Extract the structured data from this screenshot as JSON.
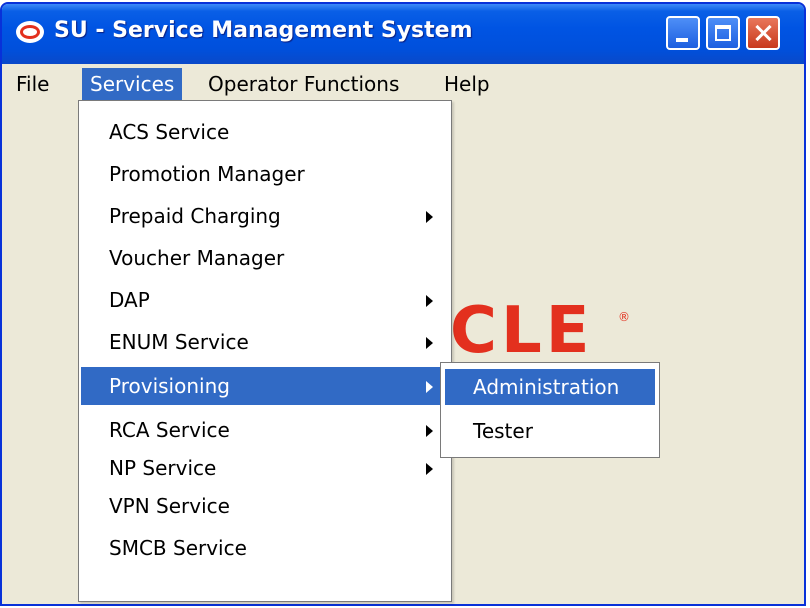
{
  "window": {
    "title": "SU - Service Management System",
    "logo_icon": "oracle-logo-icon"
  },
  "menubar": {
    "items": [
      {
        "label": "File"
      },
      {
        "label": "Services",
        "active": true
      },
      {
        "label": "Operator Functions"
      },
      {
        "label": "Help"
      }
    ]
  },
  "background": {
    "brand_text": "CLE",
    "brand_color": "#e3301e"
  },
  "services_menu": {
    "items": [
      {
        "label": "ACS Service",
        "submenu": false
      },
      {
        "label": "Promotion Manager",
        "submenu": false
      },
      {
        "label": "Prepaid Charging",
        "submenu": true
      },
      {
        "label": "Voucher Manager",
        "submenu": false
      },
      {
        "label": "DAP",
        "submenu": true
      },
      {
        "label": "ENUM Service",
        "submenu": true
      },
      {
        "label": "Provisioning",
        "submenu": true,
        "active": true
      },
      {
        "label": "RCA Service",
        "submenu": true
      },
      {
        "label": "NP Service",
        "submenu": true
      },
      {
        "label": "VPN Service",
        "submenu": false
      },
      {
        "label": "SMCB Service",
        "submenu": false
      }
    ]
  },
  "provisioning_submenu": {
    "items": [
      {
        "label": "Administration",
        "active": true
      },
      {
        "label": "Tester"
      }
    ]
  },
  "colors": {
    "title_bar": "#0054e3",
    "selection": "#316ac5",
    "window_bg": "#ece9d8"
  }
}
